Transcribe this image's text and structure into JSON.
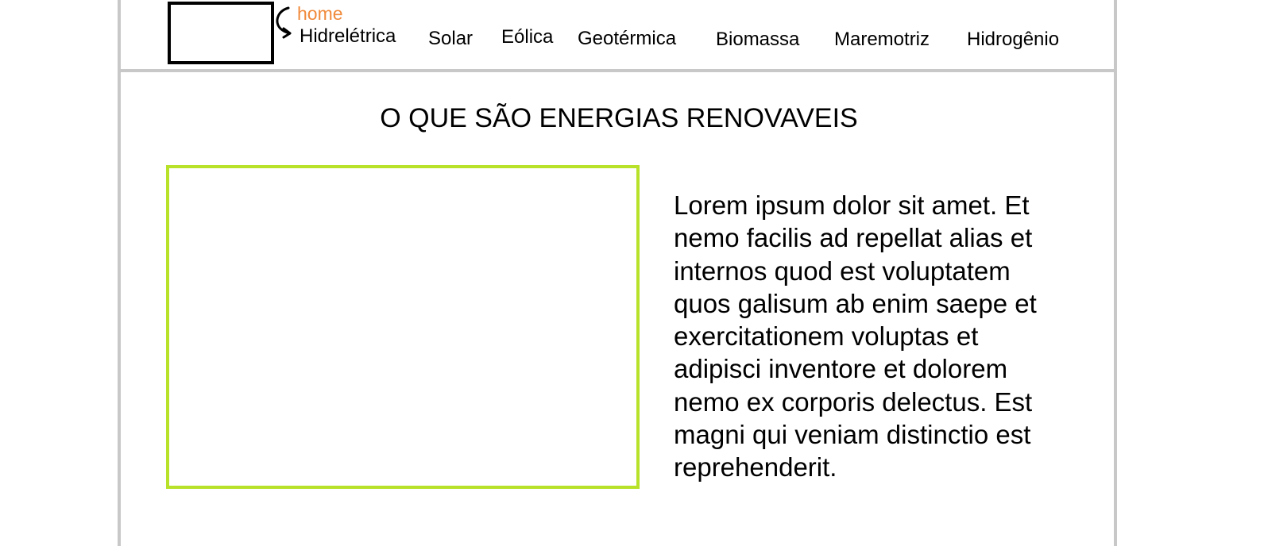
{
  "header": {
    "logo": "logo-placeholder",
    "annotation": {
      "label": "home",
      "color": "#f08a3c",
      "icon": "curved-arrow-icon"
    },
    "nav": [
      "Hidrelétrica",
      "Solar",
      "Eólica",
      "Geotérmica",
      "Biomassa",
      "Maremotriz",
      "Hidrogênio"
    ]
  },
  "main": {
    "title": "O QUE SÃO ENERGIAS RENOVAVEIS",
    "image": {
      "icon": "image-placeholder",
      "border_color": "#b8e22a"
    },
    "paragraph": "Lorem ipsum dolor sit amet. Et nemo facilis ad repellat alias et internos quod est voluptatem quos galisum ab enim saepe et exercitationem voluptas et adipisci inventore et dolorem nemo ex corporis delectus. Est magni qui veniam distinctio est reprehenderit."
  },
  "colors": {
    "frame": "#c8c8c8",
    "text": "#000000"
  }
}
